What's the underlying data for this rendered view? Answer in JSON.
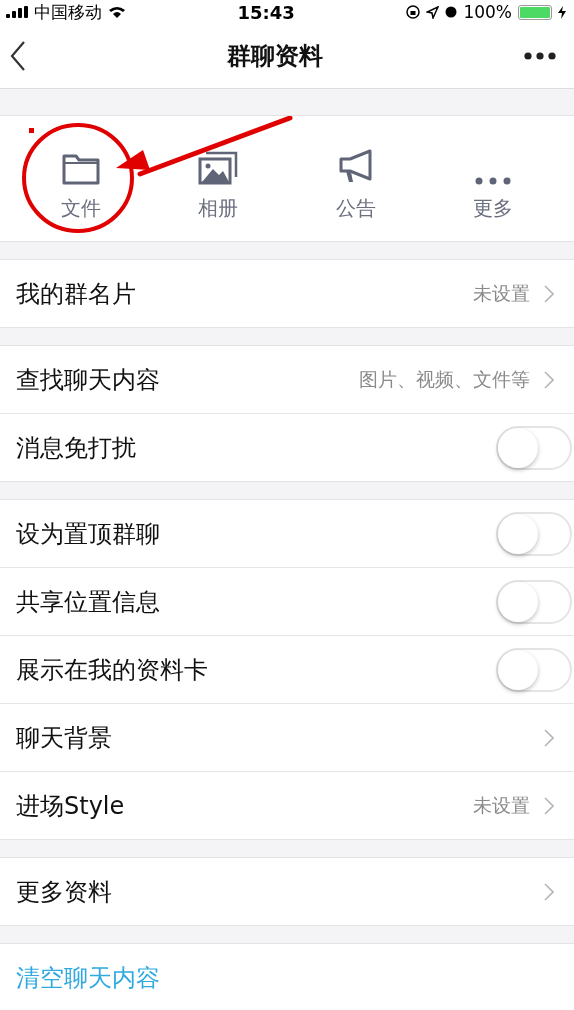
{
  "status_bar": {
    "carrier": "中国移动",
    "time": "15:43",
    "battery": "100%"
  },
  "nav": {
    "title": "群聊资料"
  },
  "shortcuts": [
    {
      "kind": "folder",
      "label": "文件"
    },
    {
      "kind": "album",
      "label": "相册"
    },
    {
      "kind": "megaphone",
      "label": "公告"
    },
    {
      "kind": "more",
      "label": "更多"
    }
  ],
  "sections": [
    {
      "rows": [
        {
          "kind": "link",
          "label": "我的群名片",
          "value": "未设置"
        }
      ]
    },
    {
      "rows": [
        {
          "kind": "link",
          "label": "查找聊天内容",
          "value": "图片、视频、文件等"
        },
        {
          "kind": "toggle",
          "label": "消息免打扰",
          "on": false
        }
      ]
    },
    {
      "rows": [
        {
          "kind": "toggle",
          "label": "设为置顶群聊",
          "on": false
        },
        {
          "kind": "toggle",
          "label": "共享位置信息",
          "on": false
        },
        {
          "kind": "toggle",
          "label": "展示在我的资料卡",
          "on": false
        },
        {
          "kind": "link",
          "label": "聊天背景"
        },
        {
          "kind": "link",
          "label": "进场Style",
          "value": "未设置"
        }
      ]
    },
    {
      "rows": [
        {
          "kind": "link",
          "label": "更多资料"
        }
      ]
    },
    {
      "rows": [
        {
          "kind": "action",
          "label": "清空聊天内容"
        }
      ]
    }
  ]
}
